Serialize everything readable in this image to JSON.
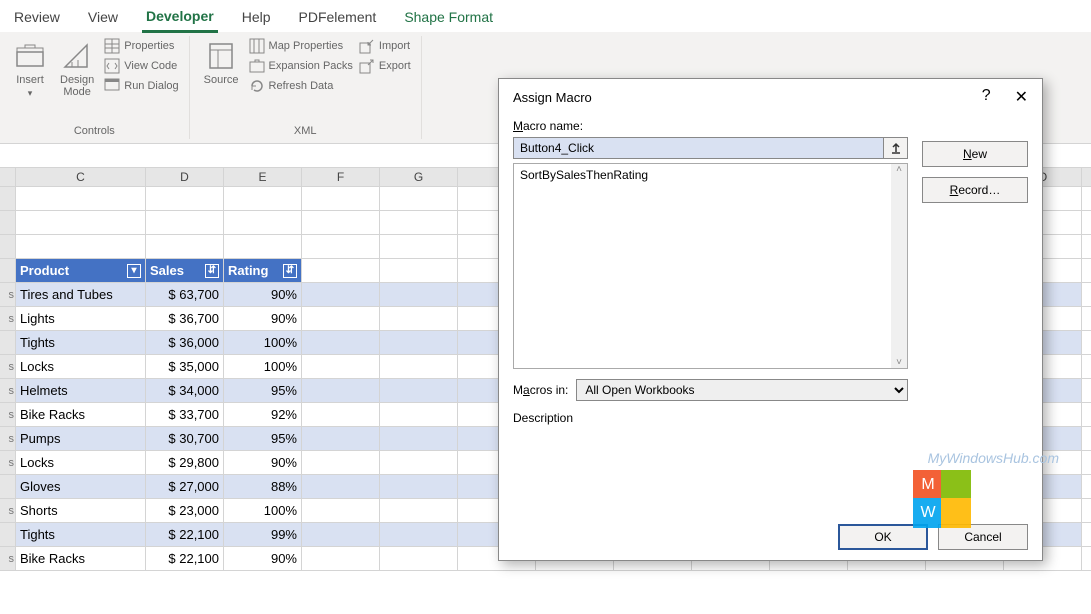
{
  "ribbon_tabs": [
    "Review",
    "View",
    "Developer",
    "Help",
    "PDFelement",
    "Shape Format"
  ],
  "ribbon": {
    "controls": {
      "insert": "Insert",
      "design": "Design\nMode",
      "props": "Properties",
      "viewcode": "View Code",
      "rundialog": "Run Dialog",
      "label": "Controls"
    },
    "xml": {
      "source": "Source",
      "mapprops": "Map Properties",
      "expansion": "Expansion Packs",
      "refresh": "Refresh Data",
      "import": "Import",
      "export": "Export",
      "label": "XML"
    }
  },
  "cols": [
    "",
    "C",
    "D",
    "E",
    "F",
    "G",
    "",
    "",
    "",
    "",
    "",
    "",
    "",
    "O"
  ],
  "table": {
    "headers": [
      "Product",
      "Sales",
      "Rating"
    ],
    "rows": [
      {
        "p": "Tires and Tubes",
        "s": "$ 63,700",
        "r": "90%",
        "cut": "s",
        "band": true
      },
      {
        "p": "Lights",
        "s": "$ 36,700",
        "r": "90%",
        "cut": "s",
        "band": false
      },
      {
        "p": "Tights",
        "s": "$ 36,000",
        "r": "100%",
        "cut": "",
        "band": true
      },
      {
        "p": "Locks",
        "s": "$ 35,000",
        "r": "100%",
        "cut": "s",
        "band": false
      },
      {
        "p": "Helmets",
        "s": "$ 34,000",
        "r": "95%",
        "cut": "s",
        "band": true
      },
      {
        "p": "Bike Racks",
        "s": "$ 33,700",
        "r": "92%",
        "cut": "s",
        "band": false
      },
      {
        "p": "Pumps",
        "s": "$ 30,700",
        "r": "95%",
        "cut": "s",
        "band": true
      },
      {
        "p": "Locks",
        "s": "$ 29,800",
        "r": "90%",
        "cut": "s",
        "band": false
      },
      {
        "p": "Gloves",
        "s": "$ 27,000",
        "r": "88%",
        "cut": "",
        "band": true
      },
      {
        "p": "Shorts",
        "s": "$ 23,000",
        "r": "100%",
        "cut": "s",
        "band": false
      },
      {
        "p": "Tights",
        "s": "$ 22,100",
        "r": "99%",
        "cut": "",
        "band": true
      },
      {
        "p": "Bike Racks",
        "s": "$ 22,100",
        "r": "90%",
        "cut": "s",
        "band": false
      }
    ]
  },
  "dialog": {
    "title": "Assign Macro",
    "macro_label": "Macro name:",
    "macro_value": "Button4_Click",
    "list_item": "SortBySalesThenRating",
    "macros_in_label": "Macros in:",
    "macros_in_value": "All Open Workbooks",
    "description": "Description",
    "new": "New",
    "record": "Record…",
    "ok": "OK",
    "cancel": "Cancel"
  },
  "watermark": "MyWindowsHub.com"
}
